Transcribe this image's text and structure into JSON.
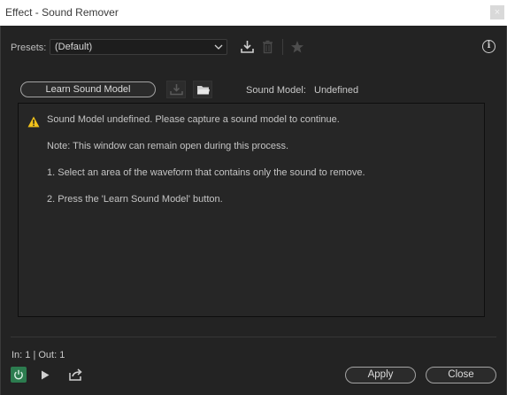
{
  "window": {
    "title": "Effect - Sound Remover",
    "close_glyph": "×"
  },
  "toolbar": {
    "presets_label": "Presets:",
    "preset_value": "(Default)",
    "icons": [
      "download-preset-icon",
      "trash-icon",
      "star-icon",
      "info-icon"
    ],
    "info_glyph": "i",
    "chevron_glyph": "⌄"
  },
  "learn": {
    "button_label": "Learn Sound Model",
    "icons": [
      "save-model-icon",
      "folder-open-icon"
    ],
    "model_label": "Sound Model:",
    "model_value": "Undefined"
  },
  "messages": {
    "warning": "Sound Model undefined. Please capture a sound model to continue.",
    "note": "Note: This window can remain open during this process.",
    "step1": "1. Select an area of the waveform that contains only the sound to remove.",
    "step2": "2. Press the 'Learn Sound Model' button."
  },
  "footer": {
    "inout": "In: 1 | Out: 1",
    "apply_label": "Apply",
    "close_label": "Close",
    "icons": [
      "power-icon",
      "play-icon",
      "export-icon"
    ]
  },
  "colors": {
    "background": "#232323",
    "panel": "#262626",
    "power_active": "#2c7c4f",
    "warning": "#f2c21b"
  }
}
